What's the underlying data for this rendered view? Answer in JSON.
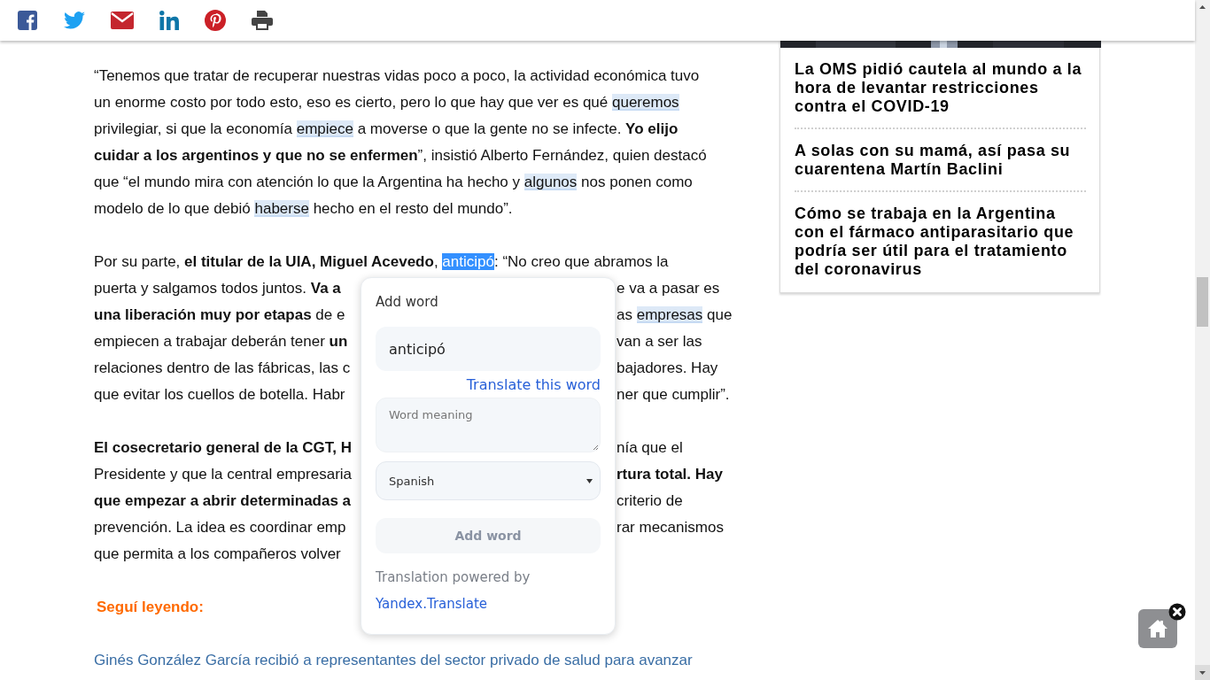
{
  "article": {
    "paragraphs": [
      {
        "lines": [
          {
            "segs": [
              {
                "text": "“Tenemos que tratar de recuperar nuestras vidas poco a poco, la actividad económica tuvo",
                "kind": "plain"
              }
            ]
          },
          {
            "segs": [
              {
                "text": "un enorme costo por todo esto, eso es cierto, pero lo que hay que ver es qué ",
                "kind": "plain"
              },
              {
                "text": "queremos",
                "kind": "marked"
              }
            ]
          },
          {
            "segs": [
              {
                "text": "privilegiar, si que la economía ",
                "kind": "plain"
              },
              {
                "text": "empiece",
                "kind": "marked"
              },
              {
                "text": " a moverse o que la gente no se infecte. ",
                "kind": "plain"
              },
              {
                "text": "Yo elijo",
                "kind": "bold"
              }
            ]
          },
          {
            "segs": [
              {
                "text": "cuidar a los argentinos y que no se enfermen",
                "kind": "bold"
              },
              {
                "text": "”, insistió Alberto Fernández, quien destacó",
                "kind": "plain"
              }
            ]
          },
          {
            "segs": [
              {
                "text": "que “el mundo mira con atención lo que la Argentina ha hecho y ",
                "kind": "plain"
              },
              {
                "text": "algunos",
                "kind": "marked"
              },
              {
                "text": " nos ponen como",
                "kind": "plain"
              }
            ]
          },
          {
            "segs": [
              {
                "text": "modelo de lo que debió ",
                "kind": "plain"
              },
              {
                "text": "haberse",
                "kind": "marked"
              },
              {
                "text": " hecho en el resto del mundo”.",
                "kind": "plain"
              }
            ]
          }
        ]
      },
      {
        "lines": [
          {
            "segs": [
              {
                "text": "Por su parte, ",
                "kind": "plain"
              },
              {
                "text": "el titular de la UIA, Miguel Acevedo",
                "kind": "bold"
              },
              {
                "text": ", ",
                "kind": "plain"
              },
              {
                "text": "anticipó",
                "kind": "selected"
              },
              {
                "text": ": “No creo que abramos la",
                "kind": "plain"
              }
            ]
          },
          {
            "segs": [
              {
                "text": "puerta y salgamos todos juntos. ",
                "kind": "plain"
              },
              {
                "text": "Va a",
                "kind": "bold"
              }
            ],
            "right": [
              {
                "text": "e va a pasar es",
                "kind": "plain"
              }
            ]
          },
          {
            "segs": [
              {
                "text": "una liberación muy por etapas",
                "kind": "bold"
              },
              {
                "text": " de e",
                "kind": "plain"
              }
            ],
            "right": [
              {
                "text": "as ",
                "kind": "plain"
              },
              {
                "text": "empresas",
                "kind": "marked"
              },
              {
                "text": " que",
                "kind": "plain"
              }
            ]
          },
          {
            "segs": [
              {
                "text": "empiecen a trabajar deberán tener ",
                "kind": "plain"
              },
              {
                "text": "un",
                "kind": "bold"
              }
            ],
            "right": [
              {
                "text": "van a ser las",
                "kind": "plain"
              }
            ]
          },
          {
            "segs": [
              {
                "text": "relaciones dentro de las fábricas, las c",
                "kind": "plain"
              }
            ],
            "right": [
              {
                "text": "bajadores. Hay",
                "kind": "plain"
              }
            ]
          },
          {
            "segs": [
              {
                "text": "que evitar los cuellos de botella. Habr",
                "kind": "plain"
              }
            ],
            "right": [
              {
                "text": "ner que cumplir”.",
                "kind": "plain"
              }
            ]
          }
        ]
      },
      {
        "lines": [
          {
            "segs": [
              {
                "text": "El cosecretario general de la CGT, H",
                "kind": "bold"
              }
            ],
            "right": [
              {
                "text": "nía que el",
                "kind": "plain"
              }
            ]
          },
          {
            "segs": [
              {
                "text": "Presidente y que la central empresaria",
                "kind": "plain"
              }
            ],
            "right": [
              {
                "text": "rtura total. Hay",
                "kind": "bold"
              }
            ]
          },
          {
            "segs": [
              {
                "text": "que empezar a abrir determinadas a",
                "kind": "bold"
              }
            ],
            "right": [
              {
                "text": "criterio de",
                "kind": "plain"
              }
            ]
          },
          {
            "segs": [
              {
                "text": "prevención. La idea es coordinar emp",
                "kind": "plain"
              }
            ],
            "right": [
              {
                "text": "rar mecanismos",
                "kind": "plain"
              }
            ]
          },
          {
            "segs": [
              {
                "text": "que permita a los compañeros volver",
                "kind": "plain"
              }
            ]
          }
        ]
      }
    ],
    "read_more": "Seguí leyendo:",
    "related_link": "Ginés González García recibió a representantes del sector privado de salud para avanzar"
  },
  "sidebar": {
    "picture": {
      "kind": "picture"
    },
    "headlines": [
      "La OMS pidió cautela al mundo a la hora de levantar restricciones contra el COVID-19",
      "A solas con su mamá, así pasa su cuarentena Martín Baclini",
      "Cómo se trabaja en la Argentina con el fármaco antiparasitario que podría ser útil para el tratamiento del coronavirus"
    ]
  },
  "popup": {
    "title": "Add word",
    "word": "anticipó",
    "translate_link": "Translate this word",
    "meaning_placeholder": "Word meaning",
    "language": "Spanish",
    "add_button": {
      "label": "Add word",
      "disabled": true
    },
    "powered_by": "Translation powered by",
    "provider_link": "Yandex.Translate"
  }
}
